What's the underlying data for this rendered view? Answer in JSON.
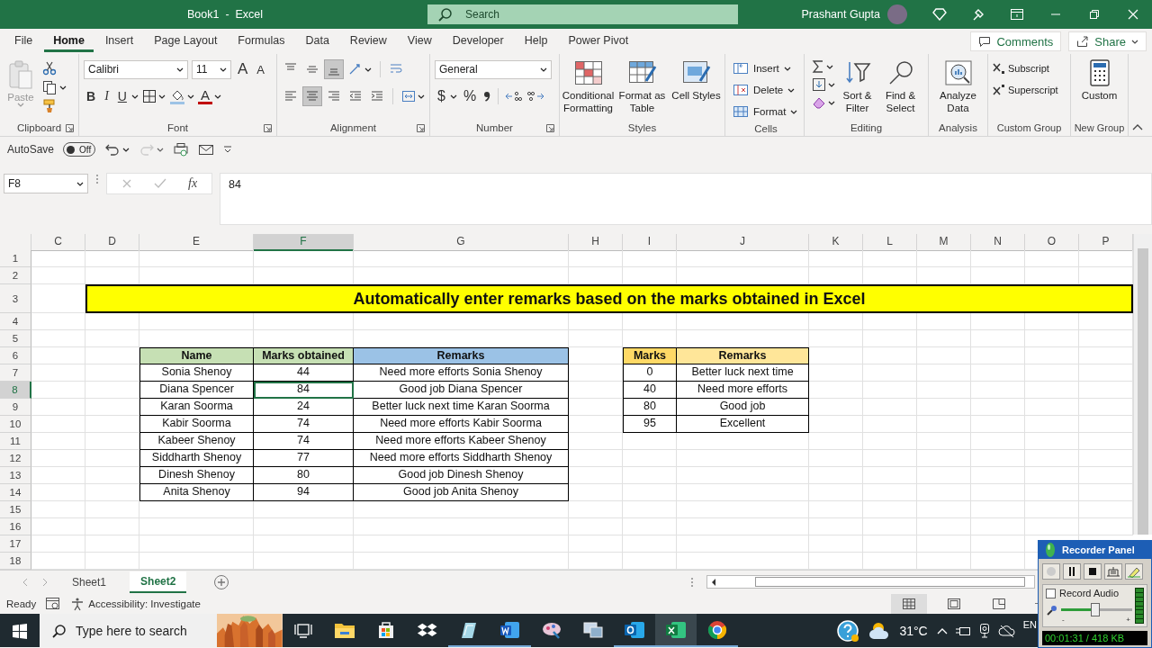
{
  "title_bar": {
    "title": "Book1  -  Excel",
    "search_placeholder": "Search",
    "user": "Prashant Gupta"
  },
  "menu_tabs": [
    {
      "label": "File",
      "selected": false
    },
    {
      "label": "Home",
      "selected": true
    },
    {
      "label": "Insert",
      "selected": false
    },
    {
      "label": "Page Layout",
      "selected": false
    },
    {
      "label": "Formulas",
      "selected": false
    },
    {
      "label": "Data",
      "selected": false
    },
    {
      "label": "Review",
      "selected": false
    },
    {
      "label": "View",
      "selected": false
    },
    {
      "label": "Developer",
      "selected": false
    },
    {
      "label": "Help",
      "selected": false
    },
    {
      "label": "Power Pivot",
      "selected": false
    }
  ],
  "comments_button": "Comments",
  "share_button": "Share",
  "ribbon_groups": [
    {
      "kind": "clipboard",
      "label": "Clipboard",
      "launcher": true,
      "paste": {
        "label": "Paste",
        "disabled": true
      }
    },
    {
      "kind": "font",
      "label": "Font",
      "launcher": true,
      "font_name": "Calibri",
      "font_size": "11",
      "grow_font": "A",
      "shrink_font": "A",
      "bold": "B",
      "italic": "I",
      "underline": "U",
      "font_color": "A"
    },
    {
      "kind": "alignment",
      "label": "Alignment",
      "launcher": true,
      "buttons": [
        {
          "kind": "align-top",
          "selected": false
        },
        {
          "kind": "align-middle",
          "selected": false
        },
        {
          "kind": "align-bottom",
          "selected": true
        },
        {
          "kind": "orientation",
          "selected": false
        },
        {
          "kind": "wrap",
          "selected": false
        },
        {
          "kind": "align-left",
          "selected": false
        },
        {
          "kind": "align-center",
          "selected": true
        },
        {
          "kind": "align-right",
          "selected": false
        },
        {
          "kind": "outdent",
          "selected": false
        },
        {
          "kind": "indent",
          "selected": false
        },
        {
          "kind": "merge",
          "selected": false
        }
      ]
    },
    {
      "kind": "number",
      "label": "Number",
      "launcher": true,
      "format": "General",
      "currency": "$",
      "percent": "%"
    },
    {
      "kind": "big",
      "label": "Styles",
      "launcher": false,
      "buttons": [
        {
          "kind": "conditional",
          "label": "Conditional Formatting"
        },
        {
          "kind": "format-table",
          "label": "Format as Table"
        },
        {
          "kind": "cell-styles",
          "label": "Cell Styles"
        }
      ]
    },
    {
      "kind": "cells",
      "label": "Cells",
      "launcher": false,
      "buttons": [
        {
          "kind": "insert-cells",
          "label": "Insert"
        },
        {
          "kind": "delete-cells",
          "label": "Delete"
        },
        {
          "kind": "format-cells",
          "label": "Format"
        }
      ]
    },
    {
      "kind": "editing",
      "label": "Editing",
      "launcher": false,
      "buttons": [
        {
          "kind": "sort-filter",
          "label": "Sort & Filter"
        },
        {
          "kind": "find",
          "label": "Find & Select"
        }
      ]
    },
    {
      "kind": "big",
      "label": "Analysis",
      "launcher": false,
      "buttons": [
        {
          "kind": "analyze",
          "label": "Analyze Data"
        }
      ]
    },
    {
      "kind": "list",
      "label": "Custom Group",
      "launcher": false,
      "buttons": [
        {
          "kind": "subscript",
          "label": "Subscript"
        },
        {
          "kind": "superscript",
          "label": "Superscript"
        }
      ]
    },
    {
      "kind": "big",
      "label": "New Group",
      "launcher": false,
      "buttons": [
        {
          "kind": "calculator",
          "label": "Custom"
        }
      ]
    }
  ],
  "quick_access": {
    "autosave": "AutoSave",
    "toggle": {
      "label": "Off",
      "on": false
    }
  },
  "formula_bar": {
    "name_box": "F8",
    "fx": "fx",
    "value": "84"
  },
  "columns": [
    {
      "label": "C",
      "selected": false
    },
    {
      "label": "D",
      "selected": false
    },
    {
      "label": "E",
      "selected": false
    },
    {
      "label": "F",
      "selected": true
    },
    {
      "label": "G",
      "selected": false
    },
    {
      "label": "H",
      "selected": false
    },
    {
      "label": "I",
      "selected": false
    },
    {
      "label": "J",
      "selected": false
    },
    {
      "label": "K",
      "selected": false
    },
    {
      "label": "L",
      "selected": false
    },
    {
      "label": "M",
      "selected": false
    },
    {
      "label": "N",
      "selected": false
    },
    {
      "label": "O",
      "selected": false
    },
    {
      "label": "P",
      "selected": false
    }
  ],
  "rows": [
    {
      "number": "1",
      "selected": false,
      "kind": "blank"
    },
    {
      "number": "2",
      "selected": false,
      "kind": "blank"
    },
    {
      "number": "3",
      "selected": false,
      "kind": "banner",
      "text": "Automatically enter remarks based on the marks obtained in Excel"
    },
    {
      "number": "4",
      "selected": false,
      "kind": "blank"
    },
    {
      "number": "5",
      "selected": false,
      "kind": "blank"
    },
    {
      "number": "6",
      "selected": false,
      "kind": "table",
      "main": [
        {
          "text": "Name",
          "kind": "header",
          "color": "#c6e0b4",
          "selected": false
        },
        {
          "text": "Marks obtained",
          "kind": "header",
          "color": "#c6e0b4",
          "selected": false
        },
        {
          "text": "Remarks",
          "kind": "header",
          "color": "#9bc2e6",
          "selected": false
        }
      ],
      "lookup": [
        {
          "text": "Marks",
          "kind": "header",
          "color": "#ffd966",
          "selected": false
        },
        {
          "text": "Remarks",
          "kind": "header",
          "color": "#ffe699",
          "selected": false
        }
      ]
    },
    {
      "number": "7",
      "selected": false,
      "kind": "table",
      "main": [
        {
          "text": "Sonia Shenoy",
          "kind": "data",
          "selected": false
        },
        {
          "text": "44",
          "kind": "data",
          "selected": false
        },
        {
          "text": "Need more efforts Sonia Shenoy",
          "kind": "data",
          "selected": false
        }
      ],
      "lookup": [
        {
          "text": "0",
          "kind": "data",
          "selected": false
        },
        {
          "text": "Better luck next time",
          "kind": "data",
          "selected": false
        }
      ]
    },
    {
      "number": "8",
      "selected": true,
      "kind": "table",
      "main": [
        {
          "text": "Diana Spencer",
          "kind": "data",
          "selected": false
        },
        {
          "text": "84",
          "kind": "data",
          "selected": true
        },
        {
          "text": "Good job Diana Spencer",
          "kind": "data",
          "selected": false
        }
      ],
      "lookup": [
        {
          "text": "40",
          "kind": "data",
          "selected": false
        },
        {
          "text": "Need more efforts",
          "kind": "data",
          "selected": false
        }
      ]
    },
    {
      "number": "9",
      "selected": false,
      "kind": "table",
      "main": [
        {
          "text": "Karan Soorma",
          "kind": "data",
          "selected": false
        },
        {
          "text": "24",
          "kind": "data",
          "selected": false
        },
        {
          "text": "Better luck next time Karan Soorma",
          "kind": "data",
          "selected": false
        }
      ],
      "lookup": [
        {
          "text": "80",
          "kind": "data",
          "selected": false
        },
        {
          "text": "Good job",
          "kind": "data",
          "selected": false
        }
      ]
    },
    {
      "number": "10",
      "selected": false,
      "kind": "table",
      "main": [
        {
          "text": "Kabir Soorma",
          "kind": "data",
          "selected": false
        },
        {
          "text": "74",
          "kind": "data",
          "selected": false
        },
        {
          "text": "Need more efforts Kabir Soorma",
          "kind": "data",
          "selected": false
        }
      ],
      "lookup": [
        {
          "text": "95",
          "kind": "data",
          "selected": false
        },
        {
          "text": "Excellent",
          "kind": "data",
          "selected": false
        }
      ]
    },
    {
      "number": "11",
      "selected": false,
      "kind": "table",
      "main": [
        {
          "text": "Kabeer Shenoy",
          "kind": "data",
          "selected": false
        },
        {
          "text": "74",
          "kind": "data",
          "selected": false
        },
        {
          "text": "Need more efforts Kabeer Shenoy",
          "kind": "data",
          "selected": false
        }
      ]
    },
    {
      "number": "12",
      "selected": false,
      "kind": "table",
      "main": [
        {
          "text": "Siddharth Shenoy",
          "kind": "data",
          "selected": false
        },
        {
          "text": "77",
          "kind": "data",
          "selected": false
        },
        {
          "text": "Need more efforts Siddharth Shenoy",
          "kind": "data",
          "selected": false
        }
      ]
    },
    {
      "number": "13",
      "selected": false,
      "kind": "table",
      "main": [
        {
          "text": "Dinesh Shenoy",
          "kind": "data",
          "selected": false
        },
        {
          "text": "80",
          "kind": "data",
          "selected": false
        },
        {
          "text": "Good job Dinesh Shenoy",
          "kind": "data",
          "selected": false
        }
      ]
    },
    {
      "number": "14",
      "selected": false,
      "kind": "table",
      "main": [
        {
          "text": "Anita Shenoy",
          "kind": "data",
          "selected": false
        },
        {
          "text": "94",
          "kind": "data",
          "selected": false
        },
        {
          "text": "Good job Anita Shenoy",
          "kind": "data",
          "selected": false
        }
      ]
    },
    {
      "number": "15",
      "selected": false,
      "kind": "blank"
    },
    {
      "number": "16",
      "selected": false,
      "kind": "blank"
    },
    {
      "number": "17",
      "selected": false,
      "kind": "blank"
    },
    {
      "number": "18",
      "selected": false,
      "kind": "blank"
    }
  ],
  "sheet_tabs": [
    {
      "label": "Sheet1",
      "selected": false
    },
    {
      "label": "Sheet2",
      "selected": true
    }
  ],
  "status_bar": {
    "status": "Ready",
    "accessibility": "Accessibility: Investigate",
    "views": [
      {
        "kind": "normal",
        "selected": true
      },
      {
        "kind": "page-layout",
        "selected": false
      },
      {
        "kind": "page-break",
        "selected": false
      }
    ]
  },
  "taskbar": {
    "search_placeholder": "Type here to search",
    "apps": [
      {
        "kind": "task-view",
        "running": false,
        "selected": false
      },
      {
        "kind": "folder",
        "running": false,
        "selected": false
      },
      {
        "kind": "store",
        "running": false,
        "selected": false
      },
      {
        "kind": "dropbox",
        "running": false,
        "selected": false
      },
      {
        "kind": "notes",
        "running": true,
        "selected": false
      },
      {
        "kind": "word",
        "running": true,
        "selected": false
      },
      {
        "kind": "paint",
        "running": false,
        "selected": false
      },
      {
        "kind": "remote",
        "running": false,
        "selected": false
      },
      {
        "kind": "outlook",
        "running": true,
        "selected": false
      },
      {
        "kind": "excel",
        "running": true,
        "selected": true
      },
      {
        "kind": "chrome",
        "running": true,
        "selected": false
      }
    ],
    "temperature": "31°C",
    "language": "EN"
  },
  "recorder_panel": {
    "title": "Recorder Panel",
    "record_audio": {
      "label": "Record Audio",
      "checked": false
    },
    "volume": {
      "level": 0.48,
      "min": "-",
      "max": "+"
    },
    "timer": "00:01:31 / 418 KB"
  }
}
